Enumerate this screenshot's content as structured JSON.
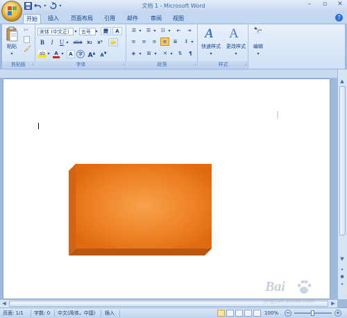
{
  "window": {
    "title": "文档 1 - Microsoft Word"
  },
  "qat": {
    "save_icon": "save-icon",
    "undo_icon": "undo-icon",
    "redo_icon": "redo-icon"
  },
  "tabs": [
    "开始",
    "插入",
    "页面布局",
    "引用",
    "邮件",
    "审阅",
    "视图"
  ],
  "ribbon": {
    "clipboard": {
      "label": "剪贴板",
      "paste": "粘贴"
    },
    "font": {
      "label": "字体",
      "font_name": "宋体 (中文正)",
      "font_size": "五号",
      "bold": "B",
      "italic": "I",
      "underline": "U",
      "strike": "abe",
      "sub": "x₂",
      "sup": "x²",
      "grow": "A",
      "shrink": "A",
      "color_a": "A"
    },
    "paragraph": {
      "label": "段落"
    },
    "styles": {
      "label": "样式",
      "quick_styles": "快速样式",
      "change_styles": "更改样式"
    },
    "editing": {
      "label": "编辑"
    }
  },
  "statusbar": {
    "page": "页面: 1/1",
    "words": "字数: 0",
    "language": "中文(简体，中国)",
    "mode": "插入",
    "zoom": "100%"
  },
  "watermark": {
    "brand": "Bai",
    "site": "jingyan.baidu.com"
  },
  "colors": {
    "shape_face": "#e8761a",
    "shape_side": "#c4600f",
    "accent": "#2f6fd1"
  }
}
